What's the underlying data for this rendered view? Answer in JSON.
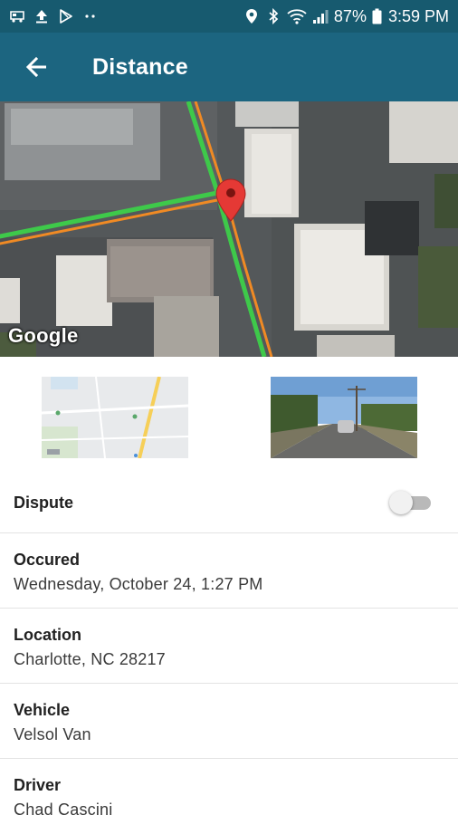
{
  "status_bar": {
    "battery": "87%",
    "time": "3:59 PM",
    "left_icons": [
      "car-notification-icon",
      "upload-icon",
      "play-store-icon",
      "more-dots-icon"
    ],
    "right_icons": [
      "location-icon",
      "bluetooth-icon",
      "wifi-icon",
      "signal-icon",
      "battery-icon"
    ]
  },
  "app_bar": {
    "title": "Distance",
    "back_icon": "arrow-left-icon",
    "background": "#1c6580"
  },
  "map": {
    "attribution": "Google",
    "marker_icon": "map-pin-icon"
  },
  "dispute": {
    "label": "Dispute",
    "toggle_on": false
  },
  "details": {
    "occured": {
      "label": "Occured",
      "value": "Wednesday, October 24, 1:27 PM"
    },
    "location": {
      "label": "Location",
      "value": "Charlotte, NC 28217"
    },
    "vehicle": {
      "label": "Vehicle",
      "value": "Velsol Van"
    },
    "driver": {
      "label": "Driver",
      "value": "Chad Cascini"
    }
  }
}
